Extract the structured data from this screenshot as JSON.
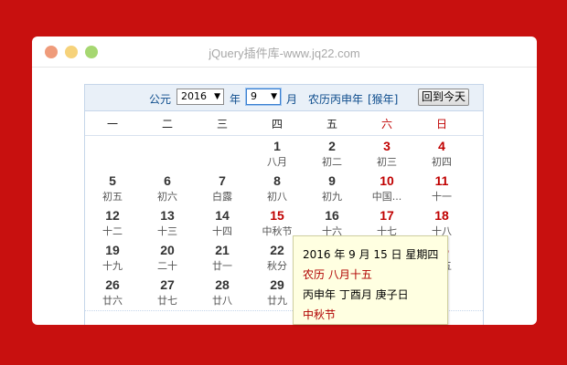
{
  "window": {
    "title": "jQuery插件库-www.jq22.com"
  },
  "calendar": {
    "header": {
      "era_label": "公元",
      "year_value": "2016",
      "year_unit": "年",
      "month_value": "9",
      "month_unit": "月",
      "lunar_year_text": "农历丙申年",
      "zodiac_text": "[猴年]",
      "today_button": "回到今天"
    },
    "weekdays": [
      "一",
      "二",
      "三",
      "四",
      "五",
      "六",
      "日"
    ],
    "days": [
      {
        "num": "1",
        "lunar": "八月",
        "weekend": false,
        "festival": false
      },
      {
        "num": "2",
        "lunar": "初二",
        "weekend": false,
        "festival": false
      },
      {
        "num": "3",
        "lunar": "初三",
        "weekend": true,
        "festival": false
      },
      {
        "num": "4",
        "lunar": "初四",
        "weekend": true,
        "festival": false
      },
      {
        "num": "5",
        "lunar": "初五",
        "weekend": false,
        "festival": false
      },
      {
        "num": "6",
        "lunar": "初六",
        "weekend": false,
        "festival": false
      },
      {
        "num": "7",
        "lunar": "白露",
        "weekend": false,
        "festival": false
      },
      {
        "num": "8",
        "lunar": "初八",
        "weekend": false,
        "festival": false
      },
      {
        "num": "9",
        "lunar": "初九",
        "weekend": false,
        "festival": false
      },
      {
        "num": "10",
        "lunar": "中国...",
        "weekend": true,
        "festival": false
      },
      {
        "num": "11",
        "lunar": "十一",
        "weekend": true,
        "festival": false
      },
      {
        "num": "12",
        "lunar": "十二",
        "weekend": false,
        "festival": false
      },
      {
        "num": "13",
        "lunar": "十三",
        "weekend": false,
        "festival": false
      },
      {
        "num": "14",
        "lunar": "十四",
        "weekend": false,
        "festival": false
      },
      {
        "num": "15",
        "lunar": "中秋节",
        "weekend": false,
        "festival": true
      },
      {
        "num": "16",
        "lunar": "十六",
        "weekend": false,
        "festival": false
      },
      {
        "num": "17",
        "lunar": "十七",
        "weekend": true,
        "festival": false
      },
      {
        "num": "18",
        "lunar": "十八",
        "weekend": true,
        "festival": false
      },
      {
        "num": "19",
        "lunar": "十九",
        "weekend": false,
        "festival": false
      },
      {
        "num": "20",
        "lunar": "二十",
        "weekend": false,
        "festival": false
      },
      {
        "num": "21",
        "lunar": "廿一",
        "weekend": false,
        "festival": false
      },
      {
        "num": "22",
        "lunar": "秋分",
        "weekend": false,
        "festival": false
      },
      {
        "num": "23",
        "lunar": "廿三",
        "weekend": false,
        "festival": false
      },
      {
        "num": "24",
        "lunar": "廿四",
        "weekend": true,
        "festival": false
      },
      {
        "num": "25",
        "lunar": "廿五",
        "weekend": true,
        "festival": false
      },
      {
        "num": "26",
        "lunar": "廿六",
        "weekend": false,
        "festival": false
      },
      {
        "num": "27",
        "lunar": "廿七",
        "weekend": false,
        "festival": false
      },
      {
        "num": "28",
        "lunar": "廿八",
        "weekend": false,
        "festival": false
      },
      {
        "num": "29",
        "lunar": "廿九",
        "weekend": false,
        "festival": false
      }
    ],
    "first_weekday_index": 3
  },
  "tooltip": {
    "date_line": "2016 年 9 月 15 日 星期四",
    "lunar_line": "农历 八月十五",
    "ganzhi_line": "丙申年 丁酉月 庚子日",
    "festival_line": "中秋节"
  },
  "colors": {
    "page_background": "#c8100f",
    "weekend_red": "#c00000",
    "header_blue": "#0d4c8c",
    "tooltip_background": "#ffffe1"
  }
}
